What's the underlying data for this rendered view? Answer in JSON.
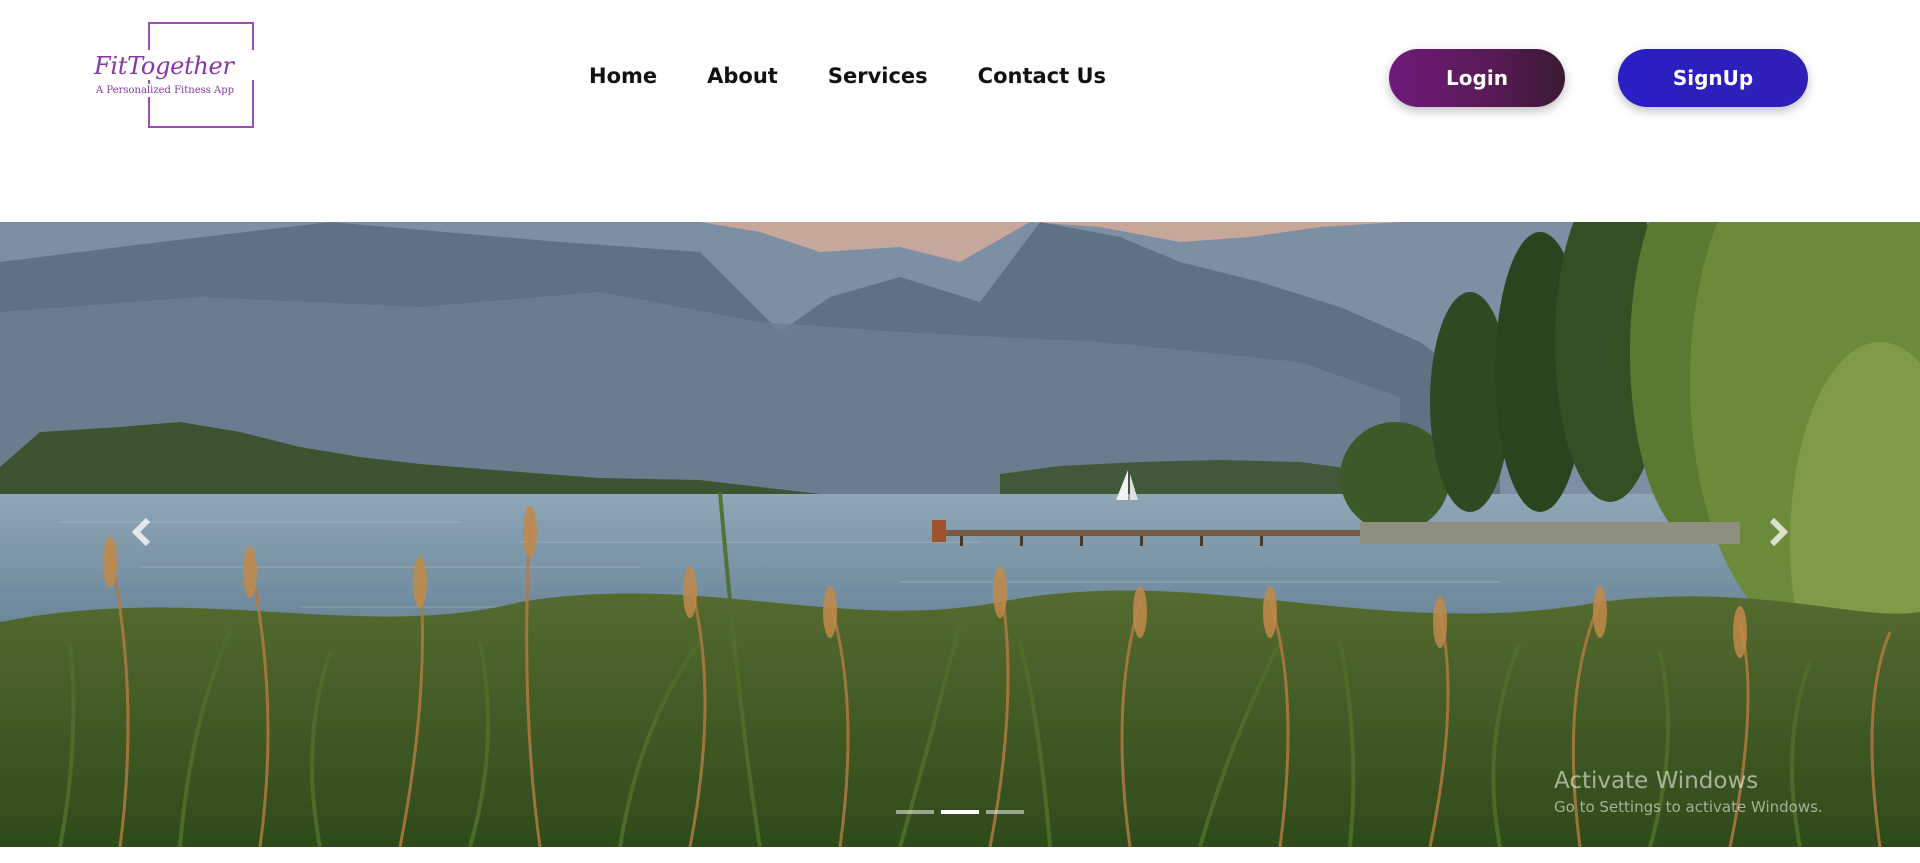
{
  "logo": {
    "title": "FitTogether",
    "subtitle": "A Personalized Fitness App"
  },
  "nav": {
    "items": [
      {
        "label": "Home"
      },
      {
        "label": "About"
      },
      {
        "label": "Services"
      },
      {
        "label": "Contact Us"
      }
    ]
  },
  "auth": {
    "login_label": "Login",
    "signup_label": "SignUp"
  },
  "carousel": {
    "prev_icon": "chevron-left-icon",
    "next_icon": "chevron-right-icon",
    "slide_count": 3,
    "active_index": 1
  },
  "watermark": {
    "title": "Activate Windows",
    "subtitle": "Go to Settings to activate Windows."
  },
  "colors": {
    "brand_purple": "#8a35a6",
    "login_start": "#6e1a7a",
    "login_end": "#3b1a33",
    "signup": "#2a1fc4"
  }
}
